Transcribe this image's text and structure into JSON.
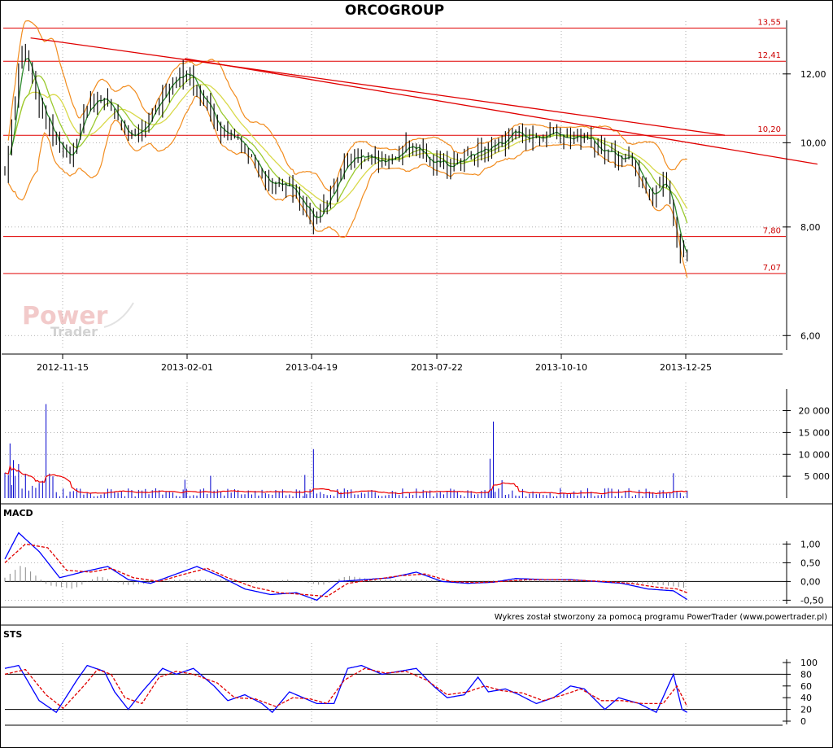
{
  "chart_data": [
    {
      "type": "line",
      "panel": "price",
      "title": "ORCOGROUP",
      "xlabel": "",
      "ylabel": "",
      "x_ticks": [
        "2012-11-15",
        "2013-02-01",
        "2013-04-19",
        "2013-07-22",
        "2013-10-10",
        "2013-12-25"
      ],
      "y_ticks": [
        "6,00",
        "8,00",
        "10,00",
        "12,00"
      ],
      "ylim": [
        5.8,
        13.8
      ],
      "scale": "log",
      "xlim_index": [
        0,
        410
      ],
      "horizontal_levels": [
        {
          "label": "13,55",
          "value": 13.55
        },
        {
          "label": "12,41",
          "value": 12.41
        },
        {
          "label": "10,20",
          "value": 10.2
        },
        {
          "label": "7,80",
          "value": 7.8
        },
        {
          "label": "7,07",
          "value": 7.07
        }
      ],
      "trendlines": [
        {
          "from": {
            "x": 15,
            "y": 13.2
          },
          "to": {
            "x": 420,
            "y": 10.2
          }
        },
        {
          "from": {
            "x": 105,
            "y": 12.5
          },
          "to": {
            "x": 474,
            "y": 9.45
          }
        }
      ],
      "close_series_anchors": [
        [
          0,
          9.2
        ],
        [
          5,
          11.0
        ],
        [
          10,
          12.9
        ],
        [
          14,
          12.1
        ],
        [
          22,
          10.8
        ],
        [
          30,
          10.0
        ],
        [
          38,
          9.6
        ],
        [
          45,
          10.7
        ],
        [
          55,
          11.4
        ],
        [
          65,
          10.7
        ],
        [
          75,
          10.0
        ],
        [
          85,
          10.8
        ],
        [
          95,
          11.6
        ],
        [
          105,
          12.1
        ],
        [
          115,
          11.3
        ],
        [
          125,
          10.4
        ],
        [
          135,
          10.2
        ],
        [
          145,
          9.5
        ],
        [
          155,
          9.0
        ],
        [
          165,
          8.9
        ],
        [
          172,
          8.5
        ],
        [
          180,
          8.1
        ],
        [
          186,
          8.4
        ],
        [
          192,
          8.9
        ],
        [
          200,
          9.6
        ],
        [
          208,
          9.7
        ],
        [
          218,
          9.5
        ],
        [
          228,
          9.7
        ],
        [
          238,
          10.0
        ],
        [
          248,
          9.5
        ],
        [
          258,
          9.4
        ],
        [
          268,
          9.6
        ],
        [
          278,
          9.8
        ],
        [
          288,
          10.0
        ],
        [
          298,
          10.3
        ],
        [
          308,
          10.1
        ],
        [
          318,
          10.3
        ],
        [
          328,
          10.2
        ],
        [
          338,
          10.1
        ],
        [
          348,
          9.8
        ],
        [
          358,
          9.7
        ],
        [
          366,
          9.6
        ],
        [
          372,
          9.1
        ],
        [
          378,
          8.6
        ],
        [
          384,
          9.1
        ],
        [
          390,
          8.2
        ],
        [
          394,
          7.5
        ],
        [
          398,
          7.4
        ]
      ],
      "overlays": [
        "Bollinger bands",
        "moving average 1",
        "moving average 2",
        "moving average 3"
      ],
      "colors": {
        "bands": "#f28c1e",
        "ma_fast": "#2e8b2e",
        "ma_mid": "#9ac92e",
        "ma_slow": "#d9d94a",
        "levels": "#e00000",
        "bars": "#000000"
      }
    },
    {
      "type": "bar",
      "panel": "volume",
      "y_ticks": [
        "5 000",
        "10 000",
        "15 000",
        "20 000"
      ],
      "ylim": [
        0,
        24000
      ],
      "average_line": true,
      "spikes": [
        [
          3,
          12500
        ],
        [
          5,
          8700
        ],
        [
          8,
          7800
        ],
        [
          24,
          21500
        ],
        [
          105,
          4200
        ],
        [
          120,
          5100
        ],
        [
          180,
          11200
        ],
        [
          175,
          5300
        ],
        [
          285,
          17500
        ],
        [
          283,
          9000
        ],
        [
          290,
          4100
        ],
        [
          390,
          5700
        ]
      ],
      "baseline_level": 1500,
      "colors": {
        "bars": "#0000cc",
        "average": "#ee0000"
      }
    },
    {
      "type": "line",
      "panel": "macd",
      "title": "MACD",
      "y_ticks": [
        "-0,50",
        "0,00",
        "0,50",
        "1,00"
      ],
      "ylim": [
        -0.6,
        1.4
      ],
      "series": [
        {
          "name": "",
          "color": "#0000ff",
          "anchors": [
            [
              0,
              0.6
            ],
            [
              8,
              1.3
            ],
            [
              20,
              0.8
            ],
            [
              32,
              0.1
            ],
            [
              45,
              0.25
            ],
            [
              60,
              0.4
            ],
            [
              72,
              0.05
            ],
            [
              85,
              -0.05
            ],
            [
              100,
              0.2
            ],
            [
              112,
              0.4
            ],
            [
              125,
              0.15
            ],
            [
              140,
              -0.2
            ],
            [
              155,
              -0.35
            ],
            [
              170,
              -0.3
            ],
            [
              182,
              -0.5
            ],
            [
              195,
              0.0
            ],
            [
              210,
              0.05
            ],
            [
              225,
              0.1
            ],
            [
              240,
              0.25
            ],
            [
              255,
              0.0
            ],
            [
              270,
              -0.05
            ],
            [
              285,
              -0.02
            ],
            [
              298,
              0.08
            ],
            [
              315,
              0.05
            ],
            [
              330,
              0.05
            ],
            [
              345,
              0.0
            ],
            [
              360,
              -0.05
            ],
            [
              375,
              -0.2
            ],
            [
              390,
              -0.25
            ],
            [
              398,
              -0.48
            ]
          ]
        },
        {
          "name": "",
          "color": "#e00000",
          "dashed": true,
          "anchors": [
            [
              0,
              0.5
            ],
            [
              12,
              1.0
            ],
            [
              25,
              0.9
            ],
            [
              36,
              0.3
            ],
            [
              50,
              0.25
            ],
            [
              62,
              0.35
            ],
            [
              75,
              0.1
            ],
            [
              90,
              0.0
            ],
            [
              105,
              0.2
            ],
            [
              118,
              0.35
            ],
            [
              130,
              0.1
            ],
            [
              145,
              -0.15
            ],
            [
              160,
              -0.3
            ],
            [
              175,
              -0.35
            ],
            [
              188,
              -0.4
            ],
            [
              200,
              -0.05
            ],
            [
              215,
              0.05
            ],
            [
              230,
              0.15
            ],
            [
              245,
              0.2
            ],
            [
              260,
              0.0
            ],
            [
              275,
              -0.03
            ],
            [
              290,
              0.0
            ],
            [
              305,
              0.05
            ],
            [
              320,
              0.05
            ],
            [
              335,
              0.03
            ],
            [
              350,
              0.0
            ],
            [
              365,
              -0.05
            ],
            [
              380,
              -0.15
            ],
            [
              392,
              -0.2
            ],
            [
              398,
              -0.3
            ]
          ]
        }
      ],
      "histogram": {
        "color": "#888888",
        "anchors": [
          [
            0,
            0.1
          ],
          [
            10,
            0.45
          ],
          [
            25,
            -0.1
          ],
          [
            40,
            -0.2
          ],
          [
            55,
            0.15
          ],
          [
            70,
            -0.1
          ],
          [
            85,
            -0.05
          ],
          [
            100,
            0.05
          ],
          [
            115,
            0.05
          ],
          [
            130,
            0.05
          ],
          [
            145,
            -0.05
          ],
          [
            165,
            0.05
          ],
          [
            185,
            -0.1
          ],
          [
            200,
            0.15
          ],
          [
            215,
            0.05
          ],
          [
            240,
            0.05
          ],
          [
            270,
            0.0
          ],
          [
            300,
            0.05
          ],
          [
            330,
            0.0
          ],
          [
            360,
            -0.03
          ],
          [
            385,
            -0.1
          ],
          [
            398,
            -0.18
          ]
        ]
      }
    },
    {
      "type": "line",
      "panel": "sts",
      "title": "STS",
      "y_ticks": [
        "0",
        "20",
        "40",
        "60",
        "80",
        "100"
      ],
      "ylim": [
        0,
        100
      ],
      "levels": [
        20,
        80
      ],
      "series": [
        {
          "name": "",
          "color": "#0000ff",
          "anchors": [
            [
              0,
              90
            ],
            [
              8,
              95
            ],
            [
              20,
              35
            ],
            [
              30,
              15
            ],
            [
              42,
              70
            ],
            [
              48,
              95
            ],
            [
              58,
              85
            ],
            [
              64,
              50
            ],
            [
              72,
              20
            ],
            [
              80,
              50
            ],
            [
              92,
              90
            ],
            [
              100,
              80
            ],
            [
              110,
              90
            ],
            [
              122,
              60
            ],
            [
              130,
              35
            ],
            [
              140,
              45
            ],
            [
              150,
              30
            ],
            [
              156,
              15
            ],
            [
              166,
              50
            ],
            [
              174,
              40
            ],
            [
              182,
              30
            ],
            [
              192,
              30
            ],
            [
              200,
              90
            ],
            [
              208,
              95
            ],
            [
              220,
              80
            ],
            [
              230,
              85
            ],
            [
              240,
              90
            ],
            [
              250,
              60
            ],
            [
              258,
              40
            ],
            [
              268,
              45
            ],
            [
              276,
              75
            ],
            [
              282,
              50
            ],
            [
              292,
              55
            ],
            [
              300,
              45
            ],
            [
              310,
              30
            ],
            [
              320,
              40
            ],
            [
              330,
              60
            ],
            [
              338,
              55
            ],
            [
              350,
              20
            ],
            [
              358,
              40
            ],
            [
              370,
              30
            ],
            [
              380,
              15
            ],
            [
              390,
              80
            ],
            [
              395,
              20
            ],
            [
              398,
              15
            ]
          ]
        },
        {
          "name": "",
          "color": "#e00000",
          "dashed": true,
          "anchors": [
            [
              0,
              80
            ],
            [
              12,
              88
            ],
            [
              24,
              45
            ],
            [
              34,
              22
            ],
            [
              46,
              60
            ],
            [
              54,
              88
            ],
            [
              62,
              80
            ],
            [
              70,
              40
            ],
            [
              80,
              30
            ],
            [
              90,
              75
            ],
            [
              100,
              85
            ],
            [
              110,
              80
            ],
            [
              124,
              65
            ],
            [
              134,
              40
            ],
            [
              146,
              38
            ],
            [
              158,
              25
            ],
            [
              168,
              40
            ],
            [
              178,
              38
            ],
            [
              188,
              30
            ],
            [
              198,
              70
            ],
            [
              210,
              90
            ],
            [
              222,
              82
            ],
            [
              234,
              85
            ],
            [
              246,
              70
            ],
            [
              258,
              45
            ],
            [
              270,
              50
            ],
            [
              280,
              60
            ],
            [
              290,
              52
            ],
            [
              302,
              48
            ],
            [
              314,
              35
            ],
            [
              326,
              45
            ],
            [
              336,
              55
            ],
            [
              348,
              35
            ],
            [
              360,
              35
            ],
            [
              372,
              30
            ],
            [
              384,
              30
            ],
            [
              392,
              60
            ],
            [
              398,
              25
            ]
          ]
        }
      ]
    }
  ],
  "brand": {
    "word1": "Power",
    "word2": "Trader"
  },
  "credit": "Wykres został stworzony za pomocą programu PowerTrader (www.powertrader.pl)"
}
